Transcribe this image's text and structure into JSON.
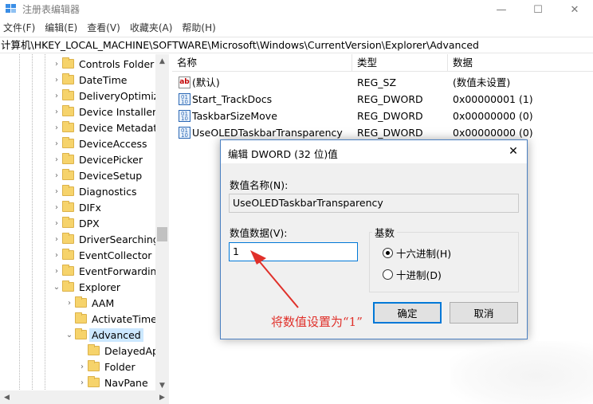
{
  "window": {
    "title": "注册表编辑器",
    "minimize": "—",
    "maximize": "☐",
    "close": "✕"
  },
  "menu": [
    "文件(F)",
    "编辑(E)",
    "查看(V)",
    "收藏夹(A)",
    "帮助(H)"
  ],
  "address": "计算机\\HKEY_LOCAL_MACHINE\\SOFTWARE\\Microsoft\\Windows\\CurrentVersion\\Explorer\\Advanced",
  "tree": {
    "items": [
      {
        "label": "Controls Folder",
        "level": 1,
        "expander": "›"
      },
      {
        "label": "DateTime",
        "level": 1,
        "expander": "›"
      },
      {
        "label": "DeliveryOptimiza",
        "level": 1,
        "expander": "›"
      },
      {
        "label": "Device Installer",
        "level": 1,
        "expander": "›"
      },
      {
        "label": "Device Metadata",
        "level": 1,
        "expander": "›"
      },
      {
        "label": "DeviceAccess",
        "level": 1,
        "expander": "›"
      },
      {
        "label": "DevicePicker",
        "level": 1,
        "expander": "›"
      },
      {
        "label": "DeviceSetup",
        "level": 1,
        "expander": "›"
      },
      {
        "label": "Diagnostics",
        "level": 1,
        "expander": "›"
      },
      {
        "label": "DIFx",
        "level": 1,
        "expander": "›"
      },
      {
        "label": "DPX",
        "level": 1,
        "expander": "›"
      },
      {
        "label": "DriverSearching",
        "level": 1,
        "expander": "›"
      },
      {
        "label": "EventCollector",
        "level": 1,
        "expander": "›"
      },
      {
        "label": "EventForwarding",
        "level": 1,
        "expander": "›"
      },
      {
        "label": "Explorer",
        "level": 1,
        "expander": "⌄"
      },
      {
        "label": "AAM",
        "level": 2,
        "expander": "›"
      },
      {
        "label": "ActivateTimec",
        "level": 2,
        "expander": ""
      },
      {
        "label": "Advanced",
        "level": 2,
        "expander": "⌄",
        "selected": true
      },
      {
        "label": "DelayedAp",
        "level": 3,
        "expander": ""
      },
      {
        "label": "Folder",
        "level": 3,
        "expander": "›"
      },
      {
        "label": "NavPane",
        "level": 3,
        "expander": "›"
      }
    ]
  },
  "list": {
    "columns": [
      "名称",
      "类型",
      "数据"
    ],
    "rows": [
      {
        "name": "(默认)",
        "type": "REG_SZ",
        "data": "(数值未设置)",
        "icon": "string-value-icon"
      },
      {
        "name": "Start_TrackDocs",
        "type": "REG_DWORD",
        "data": "0x00000001 (1)",
        "icon": "binary-value-icon"
      },
      {
        "name": "TaskbarSizeMove",
        "type": "REG_DWORD",
        "data": "0x00000000 (0)",
        "icon": "binary-value-icon"
      },
      {
        "name": "UseOLEDTaskbarTransparency",
        "type": "REG_DWORD",
        "data": "0x00000000 (0)",
        "icon": "binary-value-icon"
      }
    ]
  },
  "dialog": {
    "title": "编辑 DWORD (32 位)值",
    "close": "✕",
    "name_label": "数值名称(N):",
    "name_value": "UseOLEDTaskbarTransparency",
    "data_label": "数值数据(V):",
    "data_value": "1",
    "base_label": "基数",
    "radio_hex": "十六进制(H)",
    "radio_dec": "十进制(D)",
    "selected_base": "hex",
    "ok": "确定",
    "cancel": "取消"
  },
  "annotation": "将数值设置为“1”",
  "colors": {
    "annotation": "#e0302a",
    "selection": "#cce8ff",
    "focus": "#0078d7"
  }
}
